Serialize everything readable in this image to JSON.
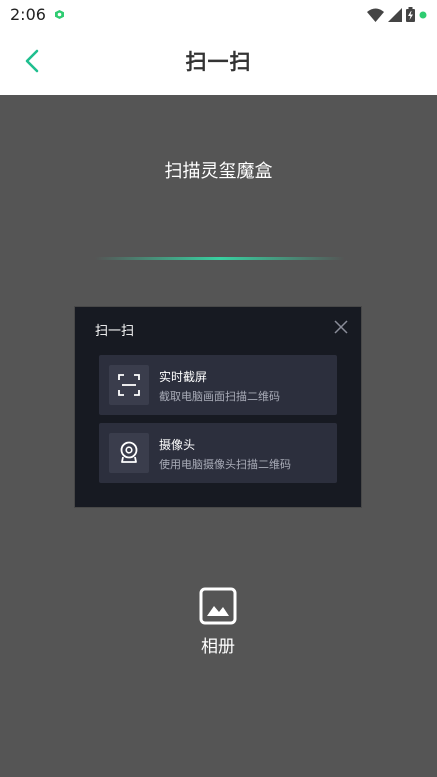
{
  "status_bar": {
    "time": "2:06"
  },
  "header": {
    "title": "扫一扫"
  },
  "scan": {
    "title": "扫描灵玺魔盒"
  },
  "dialog": {
    "title": "扫一扫",
    "options": [
      {
        "title": "实时截屏",
        "desc": "截取电脑画面扫描二维码",
        "icon": "screen-capture-icon"
      },
      {
        "title": "摄像头",
        "desc": "使用电脑摄像头扫描二维码",
        "icon": "webcam-icon"
      }
    ]
  },
  "album": {
    "label": "相册",
    "icon": "image-icon"
  },
  "colors": {
    "accent": "#1fbf8f",
    "background": "#555555",
    "dialog_bg": "#171a22",
    "option_bg": "#2c2f3d"
  }
}
